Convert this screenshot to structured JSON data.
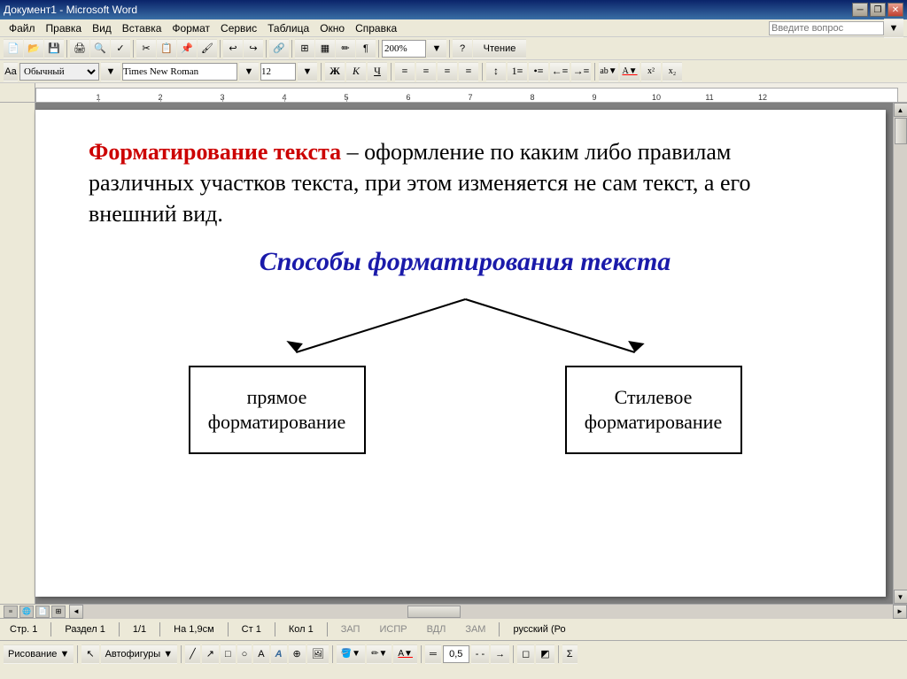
{
  "titleBar": {
    "title": "Документ1 - Microsoft Word",
    "minBtn": "0",
    "restoreBtn": "1",
    "closeBtn": "✕"
  },
  "menuBar": {
    "items": [
      "Файл",
      "Правка",
      "Вид",
      "Вставка",
      "Формат",
      "Сервис",
      "Таблица",
      "Окно",
      "Справка"
    ],
    "helpPlaceholder": "Введите вопрос"
  },
  "formatToolbar": {
    "style": "Обычный",
    "font": "Times New Roman",
    "size": "12",
    "boldLabel": "Ж",
    "italicLabel": "К",
    "underlineLabel": "Ч"
  },
  "zoomLevel": "200%",
  "readingBtn": "Чтение",
  "document": {
    "mainText": "Форматирование текста – оформление по каким либо правилам различных участков текста, при этом изменяется не сам текст, а его внешний вид.",
    "redPart": "Форматирование текста",
    "blackPart": " – оформление по каким либо правилам различных участков текста, при этом изменяется не сам текст, а его внешний вид.",
    "subtitle": "Способы форматирования текста",
    "box1": "прямое\nформатирование",
    "box2": "Стилевое\nформатирование"
  },
  "statusBar": {
    "page": "Стр. 1",
    "section": "Раздел 1",
    "pageOf": "1/1",
    "pos": "На 1,9см",
    "line": "Ст 1",
    "col": "Кол 1",
    "rec": "ЗАП",
    "isp": "ИСПР",
    "vdl": "ВДЛ",
    "zam": "ЗАМ",
    "lang": "русский (Ро"
  },
  "drawingToolbar": {
    "drawLabel": "Рисование ▼",
    "autoshapes": "Автофигуры ▼",
    "lineSize": "0,5"
  }
}
